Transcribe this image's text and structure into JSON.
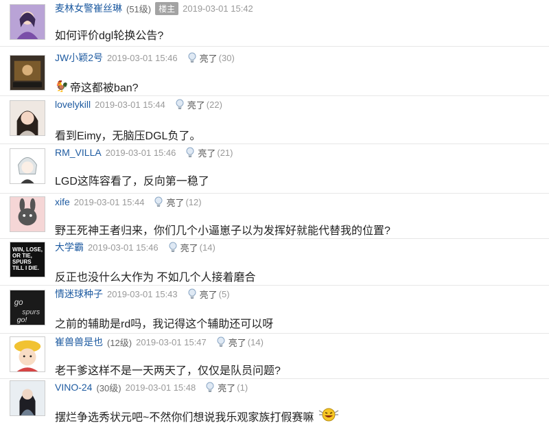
{
  "posts": [
    {
      "username": "麦林女警崔丝琳",
      "level": "(51级)",
      "badge": "楼主",
      "time": "2019-03-01 15:42",
      "content": "如何评价dgl轮换公告?"
    },
    {
      "username": "JW小颖2号",
      "time": "2019-03-01 15:46",
      "light_label": "亮了",
      "light_count": "(30)",
      "content": "帝这都被ban?"
    },
    {
      "username": "lovelykill",
      "time": "2019-03-01 15:44",
      "light_label": "亮了",
      "light_count": "(22)",
      "content": "看到Eimy，无脑压DGL负了。"
    },
    {
      "username": "RM_VILLA",
      "time": "2019-03-01 15:46",
      "light_label": "亮了",
      "light_count": "(21)",
      "content": "LGD这阵容看了，反向第一稳了"
    },
    {
      "username": "xife",
      "time": "2019-03-01 15:44",
      "light_label": "亮了",
      "light_count": "(12)",
      "content": "野王死神王者归来，你们几个小逼崽子以为发挥好就能代替我的位置?"
    },
    {
      "username": "大学霸",
      "time": "2019-03-01 15:46",
      "light_label": "亮了",
      "light_count": "(14)",
      "avatar_text": [
        "WIN, LOSE,",
        "OR TIE,",
        "SPURS",
        "TILL I DIE."
      ],
      "content": "反正也没什么大作为 不如几个人接着磨合"
    },
    {
      "username": "情迷球种子",
      "time": "2019-03-01 15:43",
      "light_label": "亮了",
      "light_count": "(5)",
      "content": "之前的辅助是rd吗，我记得这个辅助还可以呀"
    },
    {
      "username": "崔兽兽是也",
      "level": "(12级)",
      "time": "2019-03-01 15:47",
      "light_label": "亮了",
      "light_count": "(14)",
      "content": "老干爹这样不是一天两天了，仅仅是队员问题?"
    },
    {
      "username": "VINO-24",
      "level": "(30级)",
      "time": "2019-03-01 15:48",
      "light_label": "亮了",
      "light_count": "(1)",
      "content": "摆烂争选秀状元吧~不然你们想说我乐观家族打假赛嘛"
    }
  ],
  "colors": {
    "username": "#1d5aa0",
    "badge_bg": "#a3a3a3",
    "meta_gray": "#999999"
  }
}
